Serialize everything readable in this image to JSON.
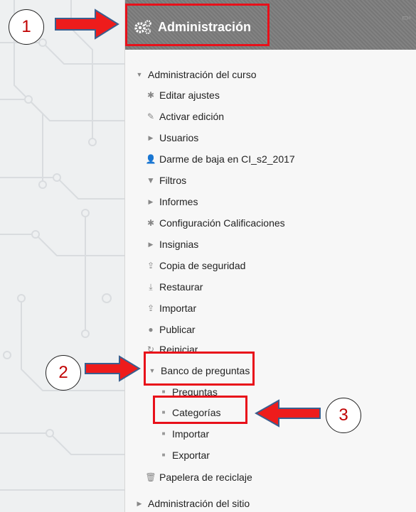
{
  "panel": {
    "title": "Administración",
    "title_icon": "gears-icon",
    "items": [
      {
        "label": "Administración del curso",
        "icon": "caret-down-icon"
      },
      {
        "label": "Editar ajustes",
        "icon": "cog-icon"
      },
      {
        "label": "Activar edición",
        "icon": "pencil-icon"
      },
      {
        "label": "Usuarios",
        "icon": "caret-right-icon"
      },
      {
        "label": "Darme de baja en CI_s2_2017",
        "icon": "user-icon"
      },
      {
        "label": "Filtros",
        "icon": "filter-icon"
      },
      {
        "label": "Informes",
        "icon": "caret-right-icon"
      },
      {
        "label": "Configuración Calificaciones",
        "icon": "cog-icon"
      },
      {
        "label": "Insignias",
        "icon": "caret-right-icon"
      },
      {
        "label": "Copia de seguridad",
        "icon": "upload-icon"
      },
      {
        "label": "Restaurar",
        "icon": "download-icon"
      },
      {
        "label": "Importar",
        "icon": "upload-icon"
      },
      {
        "label": "Publicar",
        "icon": "globe-icon"
      },
      {
        "label": "Reiniciar",
        "icon": "refresh-icon"
      },
      {
        "label": "Banco de preguntas",
        "icon": "caret-down-icon"
      },
      {
        "label": "Preguntas",
        "icon": "bullet-icon"
      },
      {
        "label": "Categorías",
        "icon": "bullet-icon"
      },
      {
        "label": "Importar",
        "icon": "bullet-icon"
      },
      {
        "label": "Exportar",
        "icon": "bullet-icon"
      },
      {
        "label": "Papelera de reciclaje",
        "icon": "trash-icon"
      },
      {
        "label": "Administración del sitio",
        "icon": "caret-right-icon"
      }
    ]
  },
  "annotations": {
    "step1": "1",
    "step2": "2",
    "step3": "3",
    "highlight_color": "#e8101a"
  }
}
